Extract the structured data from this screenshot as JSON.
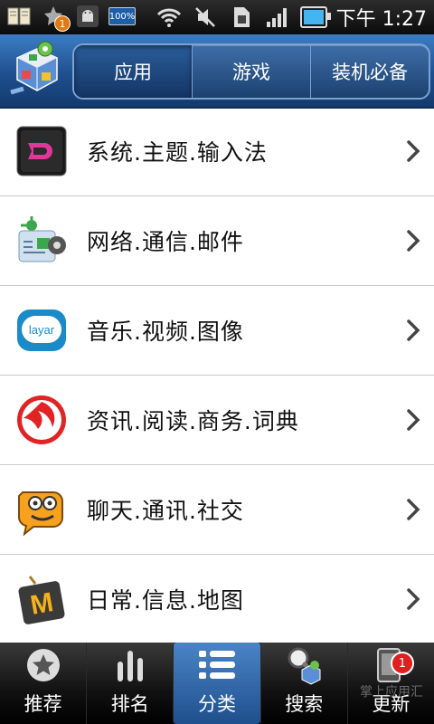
{
  "status_bar": {
    "time": "下午 1:27",
    "notification_badge": "1",
    "battery_text": "100%",
    "icons": [
      "book-icon",
      "app-update-icon",
      "android-debug-icon",
      "battery-100-icon",
      "wifi-icon",
      "mute-icon",
      "sim-icon",
      "signal-icon",
      "battery-icon"
    ]
  },
  "header": {
    "tabs": [
      {
        "label": "应用",
        "active": true
      },
      {
        "label": "游戏",
        "active": false
      },
      {
        "label": "装机必备",
        "active": false
      }
    ]
  },
  "categories": [
    {
      "label": "系统.主题.输入法",
      "icon": "theme-d-icon"
    },
    {
      "label": "网络.通信.邮件",
      "icon": "network-icon"
    },
    {
      "label": "音乐.视频.图像",
      "icon": "layar-icon"
    },
    {
      "label": "资讯.阅读.商务.词典",
      "icon": "ifeng-icon"
    },
    {
      "label": "聊天.通讯.社交",
      "icon": "chat-icon"
    },
    {
      "label": "日常.信息.地图",
      "icon": "m-icon"
    }
  ],
  "bottom_tabs": [
    {
      "label": "推荐",
      "icon": "star-icon"
    },
    {
      "label": "排名",
      "icon": "bars-icon"
    },
    {
      "label": "分类",
      "icon": "list-icon",
      "active": true
    },
    {
      "label": "搜索",
      "icon": "search-icon"
    },
    {
      "label": "更新",
      "icon": "update-icon",
      "badge": "1"
    }
  ],
  "watermark": "掌上应用汇",
  "colors": {
    "accent": "#2a5d9a",
    "badge": "#e02020"
  }
}
